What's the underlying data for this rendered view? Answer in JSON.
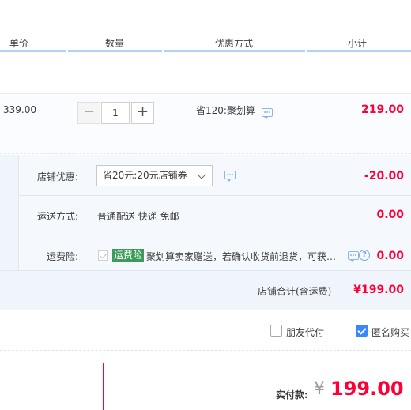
{
  "header": {
    "col_unit_price": "单价",
    "col_quantity": "数量",
    "col_promotion": "优惠方式",
    "col_subtotal": "小计"
  },
  "item": {
    "unit_price": "339.00",
    "quantity": "1",
    "minus_label": "−",
    "plus_label": "+",
    "promotion": "省120:聚划算",
    "subtotal": "219.00"
  },
  "shop": {
    "discount_label": "店铺优惠:",
    "coupon_selected": "省20元:20元店铺券",
    "discount_amount": "-20.00",
    "shipping_label": "运送方式:",
    "shipping_method": "普通配送 快递 免邮",
    "shipping_amount": "0.00",
    "insurance_label": "运费险:",
    "insurance_badge": "运费险",
    "insurance_desc": "聚划算卖家赠送，若确认收货前退货，可获…",
    "insurance_amount": "0.00",
    "help_glyph": "?",
    "total_label": "店铺合计(含运费)",
    "total_amount": "¥199.00"
  },
  "options": {
    "friend_pay_label": "朋友代付",
    "friend_pay_checked": false,
    "anonymous_label": "匿名购买",
    "anonymous_checked": true
  },
  "final": {
    "label": "实付款:",
    "currency": "¥",
    "amount": "199.00"
  },
  "colors": {
    "price_red": "#ff0036",
    "accent_blue": "#3a86ff",
    "insurance_green": "#3d9a5b"
  }
}
